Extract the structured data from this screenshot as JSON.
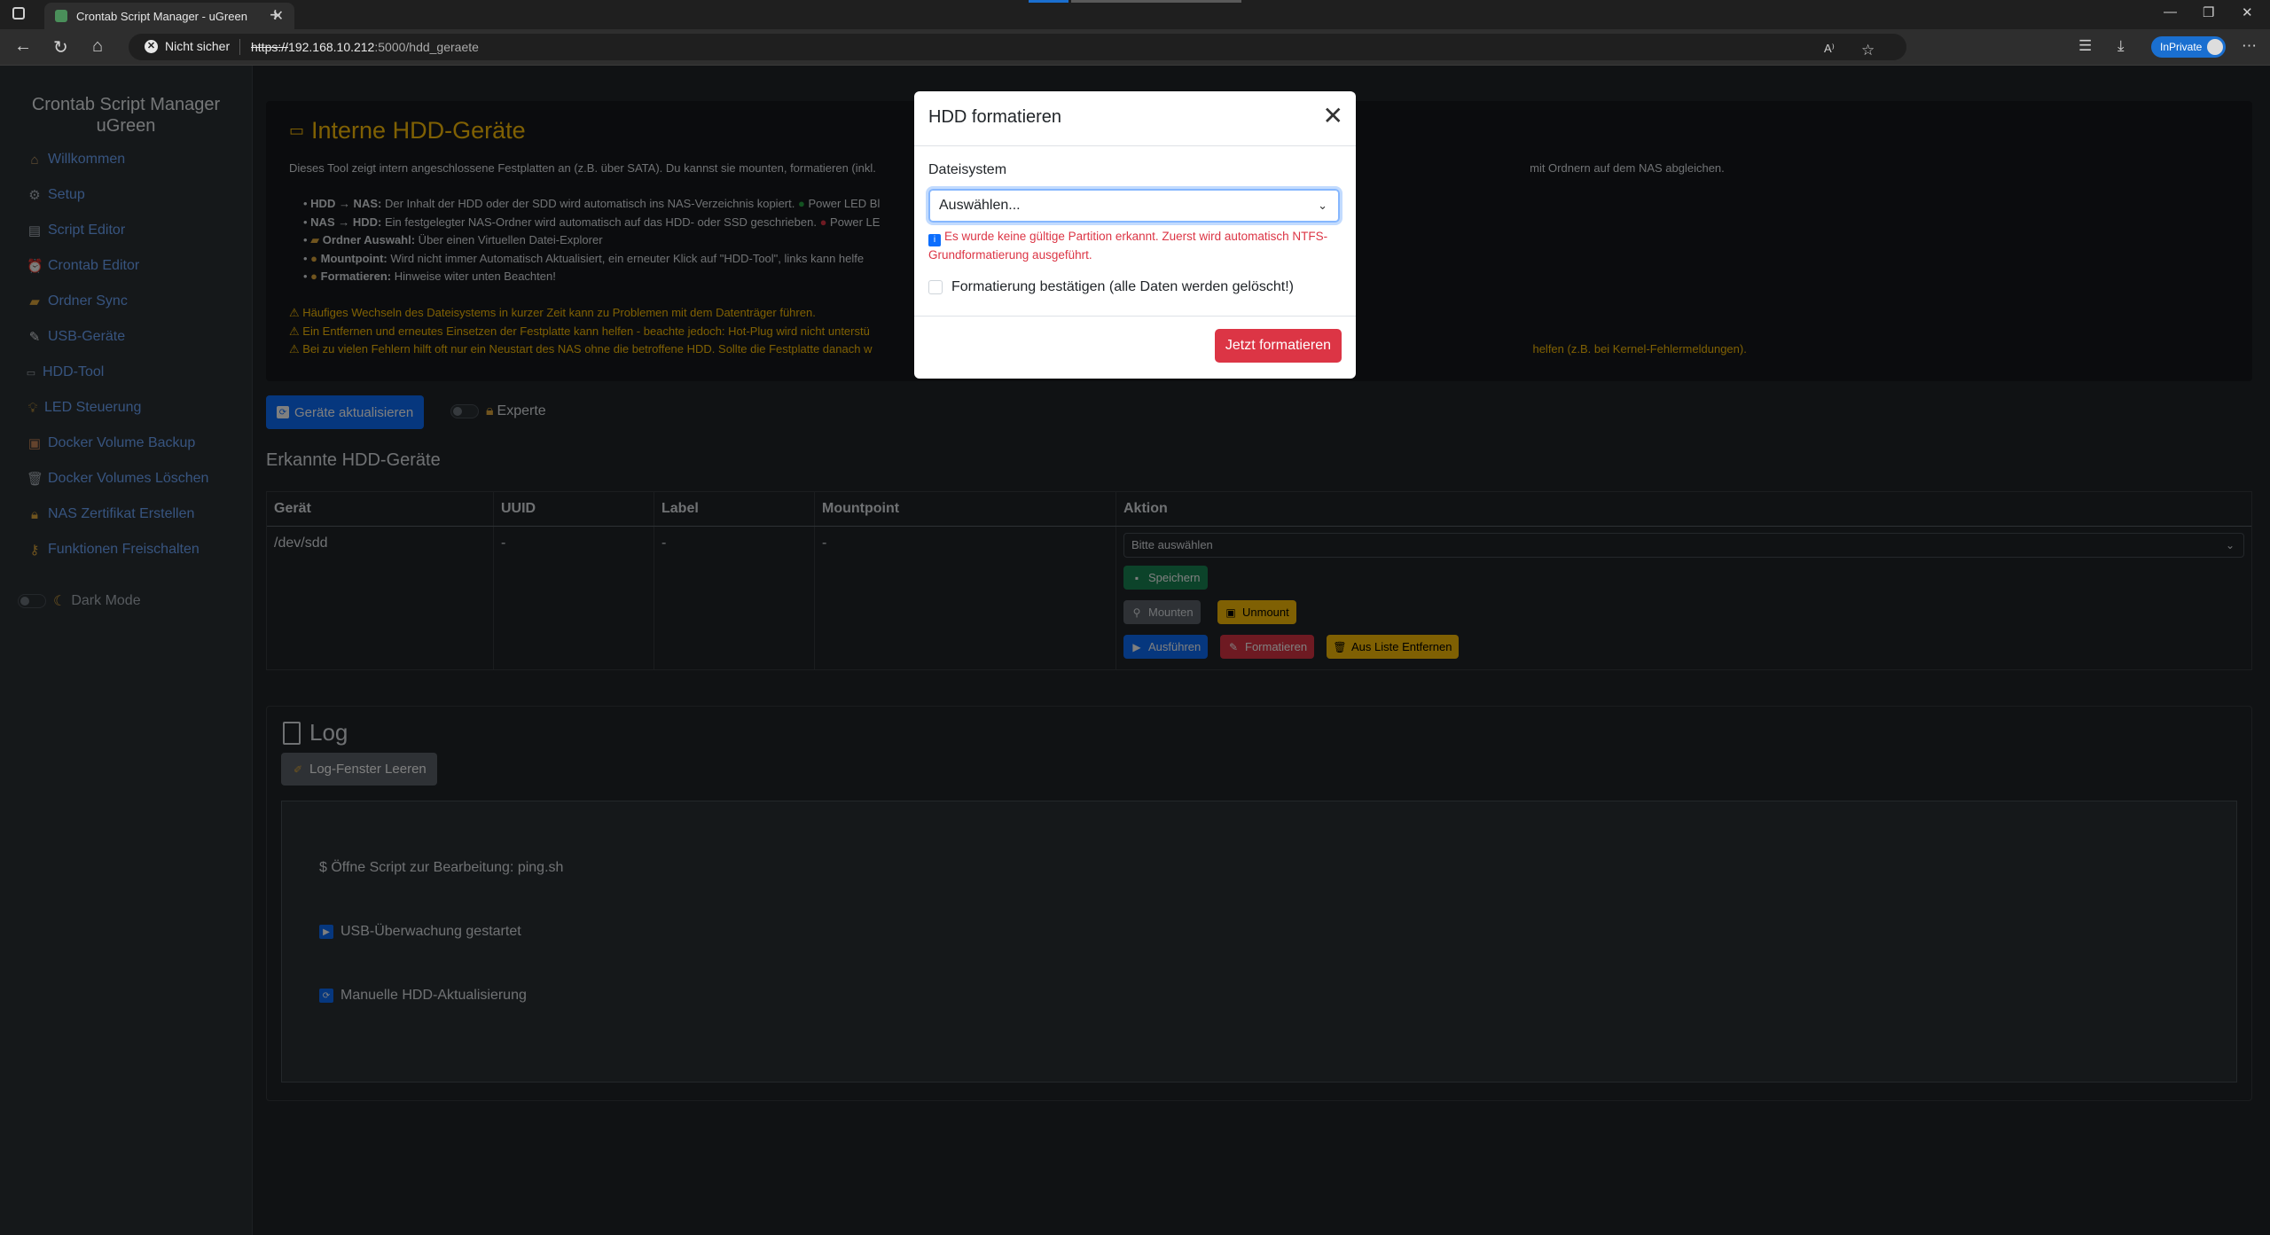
{
  "browser": {
    "tab_title": "Crontab Script Manager - uGreen",
    "security_label": "Nicht sicher",
    "url_scheme": "https://",
    "url_host": "192.168.10.212",
    "url_rest": ":5000/hdd_geraete",
    "profile_label": "InPrivate"
  },
  "sidebar": {
    "brand_line1": "Crontab Script Manager",
    "brand_line2": "uGreen",
    "items": [
      {
        "label": "Willkommen",
        "icon": "home-icon"
      },
      {
        "label": "Setup",
        "icon": "gear-icon"
      },
      {
        "label": "Script Editor",
        "icon": "document-icon"
      },
      {
        "label": "Crontab Editor",
        "icon": "alarm-clock-icon"
      },
      {
        "label": "Ordner Sync",
        "icon": "folder-icon"
      },
      {
        "label": "USB-Geräte",
        "icon": "usb-icon"
      },
      {
        "label": "HDD-Tool",
        "icon": "hdd-icon"
      },
      {
        "label": "LED Steuerung",
        "icon": "bulb-icon"
      },
      {
        "label": "Docker Volume Backup",
        "icon": "box-icon"
      },
      {
        "label": "Docker Volumes Löschen",
        "icon": "trash-icon"
      },
      {
        "label": "NAS Zertifikat Erstellen",
        "icon": "lock-icon"
      },
      {
        "label": "Funktionen Freischalten",
        "icon": "key-icon"
      }
    ],
    "dark_mode_label": "Dark Mode"
  },
  "info": {
    "title": "Interne HDD-Geräte",
    "intro_a": "Dieses Tool zeigt intern angeschlossene Festplatten an (z.B. über SATA). Du kannst sie mounten, formatieren (inkl. ",
    "intro_b": " mit Ordnern auf dem NAS abgleichen.",
    "b1_key": "HDD → NAS:",
    "b1_text": " Der Inhalt der HDD oder der SDD wird automatisch ins NAS-Verzeichnis kopiert. ",
    "b1_tail": " Power LED Bl",
    "b2_key": "NAS → HDD:",
    "b2_text": " Ein festgelegter NAS-Ordner wird automatisch auf das HDD- oder SSD geschrieben. ",
    "b2_tail": " Power LE",
    "b3_key": "Ordner Auswahl:",
    "b3_text": " Über einen Virtuellen Datei-Explorer",
    "b4_key": "Mountpoint:",
    "b4_text": " Wird nicht immer Automatisch Aktualisiert, ein erneuter Klick auf \"HDD-Tool\", links kann helfe",
    "b5_key": "Formatieren:",
    "b5_text": " Hinweise witer unten Beachten!",
    "w1": "Häufiges Wechseln des Dateisystems in kurzer Zeit kann zu Problemen mit dem Datenträger führen.",
    "w2": "Ein Entfernen und erneutes Einsetzen der Festplatte kann helfen - beachte jedoch: Hot-Plug wird nicht unterstü",
    "w3a": "Bei zu vielen Fehlern hilft oft nur ein Neustart des NAS ohne die betroffene HDD. Sollte die Festplatte danach w",
    "w3b": "helfen (z.B. bei Kernel-Fehlermeldungen)."
  },
  "toolbar": {
    "refresh_label": "Geräte aktualisieren",
    "expert_label": "Experte"
  },
  "devices": {
    "title": "Erkannte HDD-Geräte",
    "columns": [
      "Gerät",
      "UUID",
      "Label",
      "Mountpoint",
      "Aktion"
    ],
    "rows": [
      {
        "device": "/dev/sdd",
        "uuid": "-",
        "label": "-",
        "mountpoint": "-",
        "action_select": "Bitte auswählen"
      }
    ],
    "buttons": {
      "save": "Speichern",
      "mount": "Mounten",
      "unmount": "Unmount",
      "run": "Ausführen",
      "format": "Formatieren",
      "remove": "Aus Liste Entfernen"
    }
  },
  "log": {
    "title": "Log",
    "clear_label": "Log-Fenster Leeren",
    "lines": [
      "$ Öffne Script zur Bearbeitung: ping.sh",
      "USB-Überwachung gestartet",
      "Manuelle HDD-Aktualisierung"
    ]
  },
  "modal": {
    "title": "HDD formatieren",
    "fs_label": "Dateisystem",
    "fs_selected": "Auswählen...",
    "warning": "Es wurde keine gültige Partition erkannt. Zuerst wird automatisch NTFS-Grundformatierung ausgeführt.",
    "confirm_label": "Formatierung bestätigen (alle Daten werden gelöscht!)",
    "submit_label": "Jetzt formatieren"
  }
}
